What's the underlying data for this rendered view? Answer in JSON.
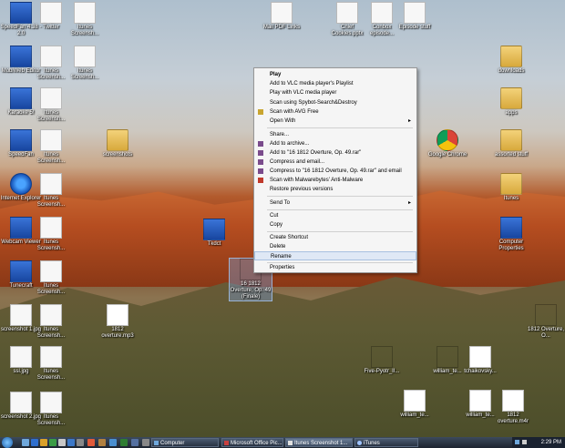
{
  "desktop": {
    "icons": [
      {
        "label": "SpeedFan 4.38 - 2.0",
        "kind": "blue"
      },
      {
        "label": "Twitter",
        "kind": "doc"
      },
      {
        "label": "Itunes Screensh...",
        "kind": "doc"
      },
      {
        "label": "Mail PDF Links",
        "kind": "doc"
      },
      {
        "label": "Chief Cookies.pptx",
        "kind": "doc"
      },
      {
        "label": "Conbox episode...",
        "kind": "doc"
      },
      {
        "label": "Episode stuff",
        "kind": "doc"
      },
      {
        "label": "MobiWeb Editor",
        "kind": "blue"
      },
      {
        "label": "Itunes Screensh...",
        "kind": "doc"
      },
      {
        "label": "Itunes Screensh...",
        "kind": "doc"
      },
      {
        "label": "downloads",
        "kind": "folder"
      },
      {
        "label": "Karaoke 5!",
        "kind": "blue"
      },
      {
        "label": "Itunes Screensh...",
        "kind": "doc"
      },
      {
        "label": "apps",
        "kind": "folder"
      },
      {
        "label": "SpeedFan",
        "kind": "blue"
      },
      {
        "label": "Itunes Screensh...",
        "kind": "doc"
      },
      {
        "label": "screenshots",
        "kind": "folder"
      },
      {
        "label": "Google Chrome",
        "kind": "chrome"
      },
      {
        "label": "assorted stuff",
        "kind": "folder"
      },
      {
        "label": "Internet Explorer",
        "kind": "ie"
      },
      {
        "label": "Itunes Screensh...",
        "kind": "doc"
      },
      {
        "label": "Itunes",
        "kind": "folder"
      },
      {
        "label": "Webcam Viewer",
        "kind": "blue"
      },
      {
        "label": "Itunes Screensh...",
        "kind": "doc"
      },
      {
        "label": "Tkdct",
        "kind": "blue"
      },
      {
        "label": "Computer Properties",
        "kind": "blue"
      },
      {
        "label": "Tunecraft",
        "kind": "blue"
      },
      {
        "label": "Itunes Screensh...",
        "kind": "doc"
      },
      {
        "label": "16 1812 Overture, Op. 49 (Finale)",
        "kind": "vlc"
      },
      {
        "label": "screenshot 1.jpg",
        "kind": "doc"
      },
      {
        "label": "Itunes Screensh...",
        "kind": "doc"
      },
      {
        "label": "1812 overture.mp3",
        "kind": "mp3"
      },
      {
        "label": "1812 Overture, O...",
        "kind": "vlc"
      },
      {
        "label": "ssl.jpg",
        "kind": "doc"
      },
      {
        "label": "Itunes Screensh...",
        "kind": "doc"
      },
      {
        "label": "Five-Pyotr_II...",
        "kind": "vlc"
      },
      {
        "label": "william_te...",
        "kind": "vlc"
      },
      {
        "label": "tchaikovsky...",
        "kind": "mp3"
      },
      {
        "label": "screenshot 2.jpg",
        "kind": "doc"
      },
      {
        "label": "Itunes Screensh...",
        "kind": "doc"
      },
      {
        "label": "william_te...",
        "kind": "mp3"
      },
      {
        "label": "william_te...",
        "kind": "mp3"
      },
      {
        "label": "1812 overture.m4r",
        "kind": "mp3"
      }
    ]
  },
  "context_menu": {
    "items": [
      {
        "label": "Play",
        "bold": true
      },
      {
        "label": "Add to VLC media player's Playlist"
      },
      {
        "label": "Play with VLC media player"
      },
      {
        "label": "Scan using Spybot-Search&Destroy"
      },
      {
        "label": "Scan with AVG Free"
      },
      {
        "label": "Open With",
        "submenu": true
      },
      {
        "label": "Share..."
      },
      {
        "label": "Add to archive..."
      },
      {
        "label": "Add to \"16 1812 Overture, Op. 49.rar\""
      },
      {
        "label": "Compress and email..."
      },
      {
        "label": "Compress to \"16 1812 Overture, Op. 49.rar\" and email"
      },
      {
        "label": "Scan with Malwarebytes' Anti-Malware"
      },
      {
        "label": "Restore previous versions"
      },
      {
        "label": "Send To",
        "submenu": true
      },
      {
        "label": "Cut"
      },
      {
        "label": "Copy"
      },
      {
        "label": "Create Shortcut"
      },
      {
        "label": "Delete"
      },
      {
        "label": "Rename"
      },
      {
        "label": "Properties"
      }
    ],
    "submenu_arrow": "▸"
  },
  "taskbar": {
    "tasks": [
      {
        "label": "Computer"
      },
      {
        "label": "Microsoft Office Pic..."
      },
      {
        "label": "Itunes Screenshot 1..."
      },
      {
        "label": "iTunes"
      }
    ],
    "clock": "2:29 PM"
  },
  "colors": {
    "menu_highlight": "#dfe8f5",
    "taskbar": "#1d2430",
    "vlc_orange": "#f28a1a"
  }
}
